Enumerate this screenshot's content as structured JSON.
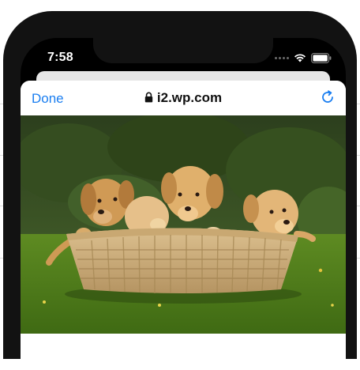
{
  "status_bar": {
    "time": "7:58",
    "wifi_icon": "wifi-icon",
    "battery_icon": "battery-icon"
  },
  "browser": {
    "done_label": "Done",
    "url": "i2.wp.com",
    "lock_icon": "lock-icon",
    "reload_icon": "reload-icon",
    "accent_color": "#1a7ef0"
  },
  "content": {
    "image": "puppies-in-basket-photo"
  }
}
